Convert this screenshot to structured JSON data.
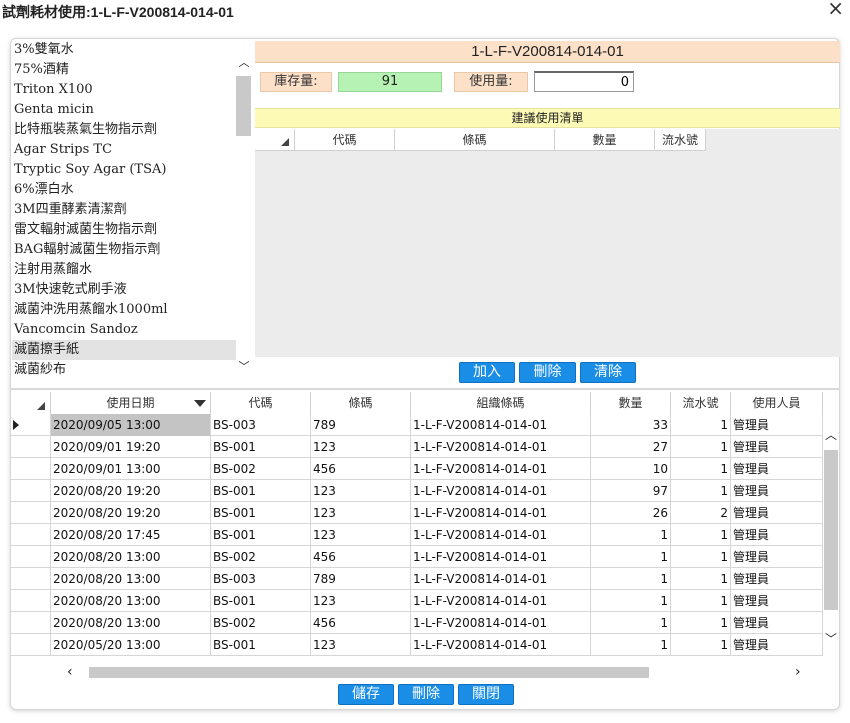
{
  "window": {
    "title": "試劑耗材使用:1-L-F-V200814-014-01"
  },
  "item_list": {
    "items": [
      "3%雙氧水",
      "75%酒精",
      "Triton X100",
      "Genta micin",
      "比特瓶裝蒸氣生物指示劑",
      "Agar Strips TC",
      "Tryptic Soy Agar (TSA)",
      "6%漂白水",
      "3M四重酵素清潔劑",
      "雷文輻射滅菌生物指示劑",
      "BAG輻射滅菌生物指示劑",
      "注射用蒸餾水",
      "3M快速乾式刷手液",
      "滅菌沖洗用蒸餾水1000ml",
      "Vancomcin Sandoz",
      "滅菌擦手紙",
      "滅菌紗布"
    ],
    "selected_index": 15
  },
  "detail": {
    "header": "1-L-F-V200814-014-01",
    "stock_label": "庫存量:",
    "stock_value": "91",
    "use_label": "使用量:",
    "use_value": "0"
  },
  "suggest": {
    "title": "建議使用清單",
    "columns": [
      "代碼",
      "條碼",
      "數量",
      "流水號"
    ],
    "buttons": {
      "add": "加入",
      "delete": "刪除",
      "clear": "清除"
    }
  },
  "log": {
    "columns": [
      "使用日期",
      "代碼",
      "條碼",
      "組織條碼",
      "數量",
      "流水號",
      "使用人員"
    ],
    "rows": [
      [
        "2020/09/05 13:00",
        "BS-003",
        "789",
        "1-L-F-V200814-014-01",
        "33",
        "1",
        "管理員"
      ],
      [
        "2020/09/01 19:20",
        "BS-001",
        "123",
        "1-L-F-V200814-014-01",
        "27",
        "1",
        "管理員"
      ],
      [
        "2020/09/01 13:00",
        "BS-002",
        "456",
        "1-L-F-V200814-014-01",
        "10",
        "1",
        "管理員"
      ],
      [
        "2020/08/20 19:20",
        "BS-001",
        "123",
        "1-L-F-V200814-014-01",
        "97",
        "1",
        "管理員"
      ],
      [
        "2020/08/20 19:20",
        "BS-001",
        "123",
        "1-L-F-V200814-014-01",
        "26",
        "2",
        "管理員"
      ],
      [
        "2020/08/20 17:45",
        "BS-001",
        "123",
        "1-L-F-V200814-014-01",
        "1",
        "1",
        "管理員"
      ],
      [
        "2020/08/20 13:00",
        "BS-002",
        "456",
        "1-L-F-V200814-014-01",
        "1",
        "1",
        "管理員"
      ],
      [
        "2020/08/20 13:00",
        "BS-003",
        "789",
        "1-L-F-V200814-014-01",
        "1",
        "1",
        "管理員"
      ],
      [
        "2020/08/20 13:00",
        "BS-001",
        "123",
        "1-L-F-V200814-014-01",
        "1",
        "1",
        "管理員"
      ],
      [
        "2020/08/20 13:00",
        "BS-002",
        "456",
        "1-L-F-V200814-014-01",
        "1",
        "1",
        "管理員"
      ],
      [
        "2020/05/20 13:00",
        "BS-001",
        "123",
        "1-L-F-V200814-014-01",
        "1",
        "1",
        "管理員"
      ]
    ]
  },
  "footer": {
    "save": "儲存",
    "delete": "刪除",
    "close": "關閉"
  }
}
